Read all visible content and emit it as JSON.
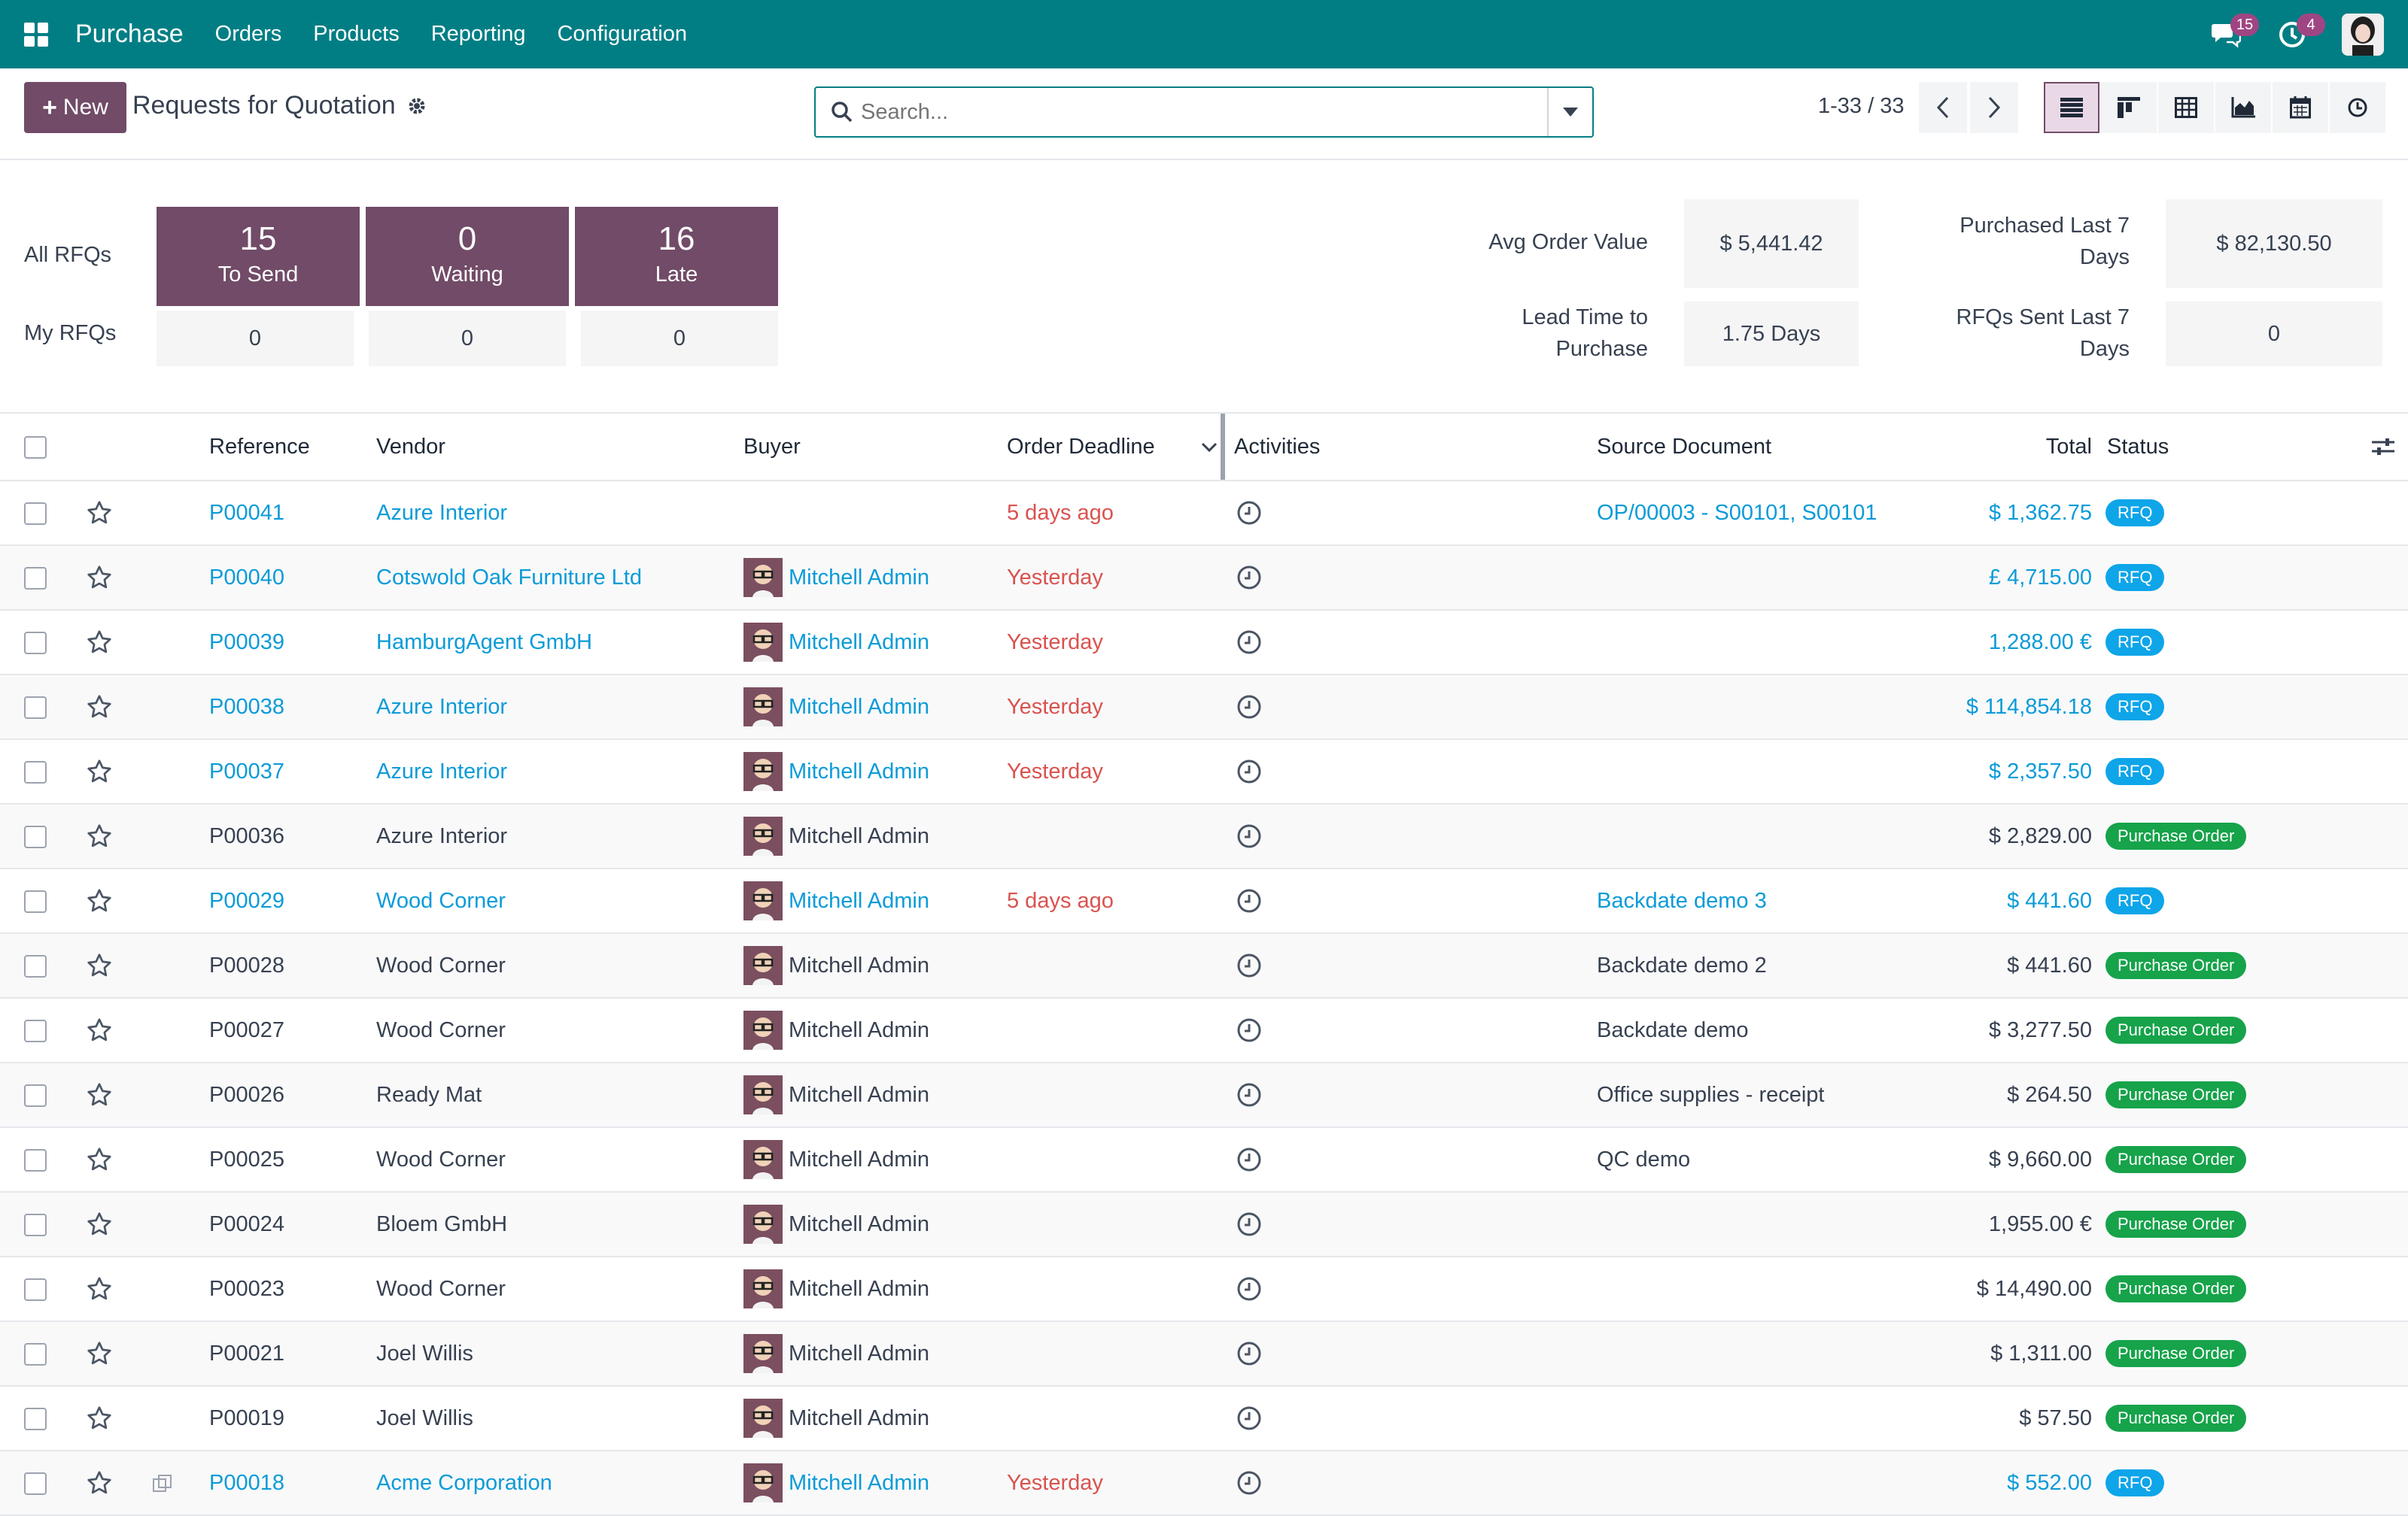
{
  "topbar": {
    "app_name": "Purchase",
    "menus": [
      "Orders",
      "Products",
      "Reporting",
      "Configuration"
    ],
    "messages_count": "15",
    "activities_count": "4"
  },
  "control": {
    "new_label": "New",
    "title": "Requests for Quotation",
    "search_placeholder": "Search...",
    "pager": "1-33 / 33"
  },
  "dashboard": {
    "all_rfqs": "All RFQs",
    "my_rfqs": "My RFQs",
    "tiles": [
      {
        "count": "15",
        "label": "To Send",
        "mine": "0"
      },
      {
        "count": "0",
        "label": "Waiting",
        "mine": "0"
      },
      {
        "count": "16",
        "label": "Late",
        "mine": "0"
      }
    ],
    "stats": {
      "avg_order_value_label": "Avg Order Value",
      "avg_order_value": "$ 5,441.42",
      "lead_time_label_1": "Lead Time to",
      "lead_time_label_2": "Purchase",
      "lead_time": "1.75 Days",
      "purchased_label_1": "Purchased Last 7",
      "purchased_label_2": "Days",
      "purchased": "$ 82,130.50",
      "rfqs_sent_label_1": "RFQs Sent Last 7",
      "rfqs_sent_label_2": "Days",
      "rfqs_sent": "0"
    }
  },
  "columns": {
    "reference": "Reference",
    "vendor": "Vendor",
    "buyer": "Buyer",
    "deadline": "Order Deadline",
    "activities": "Activities",
    "source": "Source Document",
    "total": "Total",
    "status": "Status"
  },
  "rows": [
    {
      "ref": "P00041",
      "vendor": "Azure Interior",
      "buyer": "",
      "deadline": "5 days ago",
      "source": "OP/00003 - S00101, S00101",
      "total": "$ 1,362.75",
      "status": "RFQ"
    },
    {
      "ref": "P00040",
      "vendor": "Cotswold Oak Furniture Ltd",
      "buyer": "Mitchell Admin",
      "deadline": "Yesterday",
      "source": "",
      "total": "£ 4,715.00",
      "status": "RFQ"
    },
    {
      "ref": "P00039",
      "vendor": "HamburgAgent GmbH",
      "buyer": "Mitchell Admin",
      "deadline": "Yesterday",
      "source": "",
      "total": "1,288.00 €",
      "status": "RFQ"
    },
    {
      "ref": "P00038",
      "vendor": "Azure Interior",
      "buyer": "Mitchell Admin",
      "deadline": "Yesterday",
      "source": "",
      "total": "$ 114,854.18",
      "status": "RFQ"
    },
    {
      "ref": "P00037",
      "vendor": "Azure Interior",
      "buyer": "Mitchell Admin",
      "deadline": "Yesterday",
      "source": "",
      "total": "$ 2,357.50",
      "status": "RFQ"
    },
    {
      "ref": "P00036",
      "vendor": "Azure Interior",
      "buyer": "Mitchell Admin",
      "deadline": "",
      "source": "",
      "total": "$ 2,829.00",
      "status": "Purchase Order"
    },
    {
      "ref": "P00029",
      "vendor": "Wood Corner",
      "buyer": "Mitchell Admin",
      "deadline": "5 days ago",
      "source": "Backdate demo 3",
      "total": "$ 441.60",
      "status": "RFQ"
    },
    {
      "ref": "P00028",
      "vendor": "Wood Corner",
      "buyer": "Mitchell Admin",
      "deadline": "",
      "source": "Backdate demo 2",
      "total": "$ 441.60",
      "status": "Purchase Order"
    },
    {
      "ref": "P00027",
      "vendor": "Wood Corner",
      "buyer": "Mitchell Admin",
      "deadline": "",
      "source": "Backdate demo",
      "total": "$ 3,277.50",
      "status": "Purchase Order"
    },
    {
      "ref": "P00026",
      "vendor": "Ready Mat",
      "buyer": "Mitchell Admin",
      "deadline": "",
      "source": "Office supplies - receipt",
      "total": "$ 264.50",
      "status": "Purchase Order"
    },
    {
      "ref": "P00025",
      "vendor": "Wood Corner",
      "buyer": "Mitchell Admin",
      "deadline": "",
      "source": "QC demo",
      "total": "$ 9,660.00",
      "status": "Purchase Order"
    },
    {
      "ref": "P00024",
      "vendor": "Bloem GmbH",
      "buyer": "Mitchell Admin",
      "deadline": "",
      "source": "",
      "total": "1,955.00 €",
      "status": "Purchase Order"
    },
    {
      "ref": "P00023",
      "vendor": "Wood Corner",
      "buyer": "Mitchell Admin",
      "deadline": "",
      "source": "",
      "total": "$ 14,490.00",
      "status": "Purchase Order"
    },
    {
      "ref": "P00021",
      "vendor": "Joel Willis",
      "buyer": "Mitchell Admin",
      "deadline": "",
      "source": "",
      "total": "$ 1,311.00",
      "status": "Purchase Order"
    },
    {
      "ref": "P00019",
      "vendor": "Joel Willis",
      "buyer": "Mitchell Admin",
      "deadline": "",
      "source": "",
      "total": "$ 57.50",
      "status": "Purchase Order"
    },
    {
      "ref": "P00018",
      "vendor": "Acme Corporation",
      "buyer": "Mitchell Admin",
      "deadline": "Yesterday",
      "source": "",
      "total": "$ 552.00",
      "status": "RFQ"
    }
  ],
  "colors": {
    "brand": "#017e84",
    "primary": "#714b67",
    "link": "#0b9bd8",
    "late": "#d9534f",
    "rfq": "#0ea5e9",
    "po": "#16a34a"
  }
}
